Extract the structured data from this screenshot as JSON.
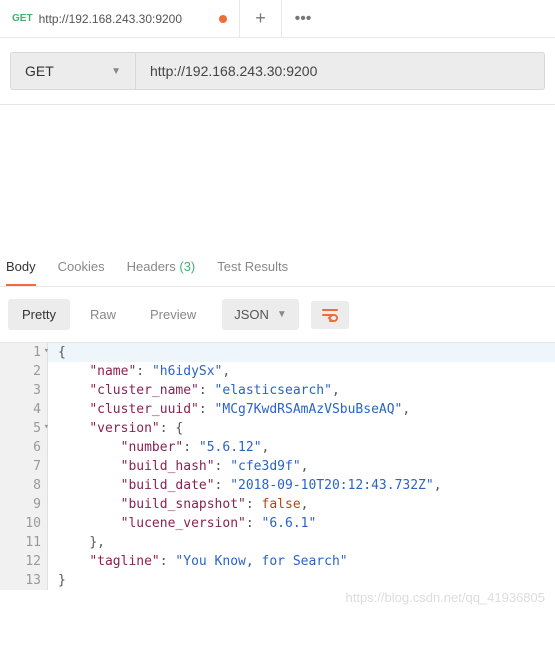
{
  "tab": {
    "method": "GET",
    "url": "http://192.168.243.30:9200"
  },
  "toolbar": {
    "add": "+",
    "more": "•••"
  },
  "request": {
    "method": "GET",
    "url": "http://192.168.243.30:9200"
  },
  "response_tabs": {
    "body": "Body",
    "cookies": "Cookies",
    "headers": "Headers",
    "headers_count": "(3)",
    "test_results": "Test Results"
  },
  "viewer": {
    "pretty": "Pretty",
    "raw": "Raw",
    "preview": "Preview",
    "format": "JSON"
  },
  "lines": {
    "1": "{",
    "2": "    \"name\": \"h6idySx\",",
    "3": "    \"cluster_name\": \"elasticsearch\",",
    "4": "    \"cluster_uuid\": \"MCg7KwdRSAmAzVSbuBseAQ\",",
    "5": "    \"version\": {",
    "6": "        \"number\": \"5.6.12\",",
    "7": "        \"build_hash\": \"cfe3d9f\",",
    "8": "        \"build_date\": \"2018-09-10T20:12:43.732Z\",",
    "9": "        \"build_snapshot\": false,",
    "10": "        \"lucene_version\": \"6.6.1\"",
    "11": "    },",
    "12": "    \"tagline\": \"You Know, for Search\"",
    "13": "}"
  },
  "watermark": "https://blog.csdn.net/qq_41936805",
  "response_json": {
    "name": "h6idySx",
    "cluster_name": "elasticsearch",
    "cluster_uuid": "MCg7KwdRSAmAzVSbuBseAQ",
    "version": {
      "number": "5.6.12",
      "build_hash": "cfe3d9f",
      "build_date": "2018-09-10T20:12:43.732Z",
      "build_snapshot": false,
      "lucene_version": "6.6.1"
    },
    "tagline": "You Know, for Search"
  }
}
